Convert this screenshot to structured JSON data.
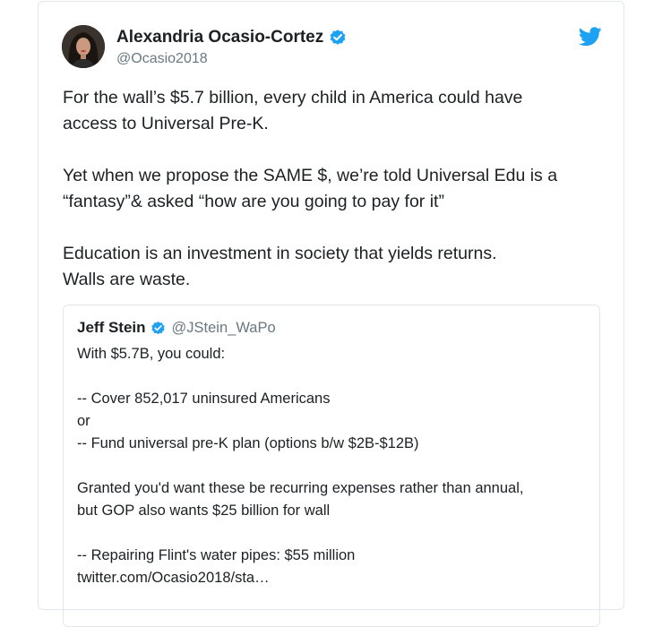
{
  "tweet": {
    "author": {
      "display_name": "Alexandria Ocasio-Cortez",
      "handle": "@Ocasio2018",
      "verified": true
    },
    "paragraphs": [
      "For the wall’s $5.7 billion, every child in America could have\naccess to Universal Pre-K.",
      "Yet when we propose the SAME $, we’re told Universal Edu is a\n“fantasy”& asked “how are you going to pay for it”",
      "Education is an investment in society that yields returns.\nWalls are waste."
    ]
  },
  "quoted_tweet": {
    "author": {
      "display_name": "Jeff Stein",
      "handle": "@JStein_WaPo",
      "verified": true
    },
    "lines": [
      "With $5.7B, you could:",
      "",
      "-- Cover 852,017 uninsured Americans",
      "or",
      "-- Fund universal pre-K plan (options b/w $2B-$12B)",
      "",
      "Granted you'd want these be recurring expenses rather than annual,",
      "but GOP also wants $25 billion for wall",
      "",
      "-- Repairing Flint's water pipes: $55 million",
      "twitter.com/Ocasio2018/sta…"
    ]
  },
  "colors": {
    "text": "#1c2022",
    "secondary_text": "#697882",
    "twitter_blue": "#1da1f2",
    "border": "#e1e8ed"
  },
  "icons": {
    "verified": "verified-badge-icon",
    "brand": "twitter-bird-icon"
  }
}
